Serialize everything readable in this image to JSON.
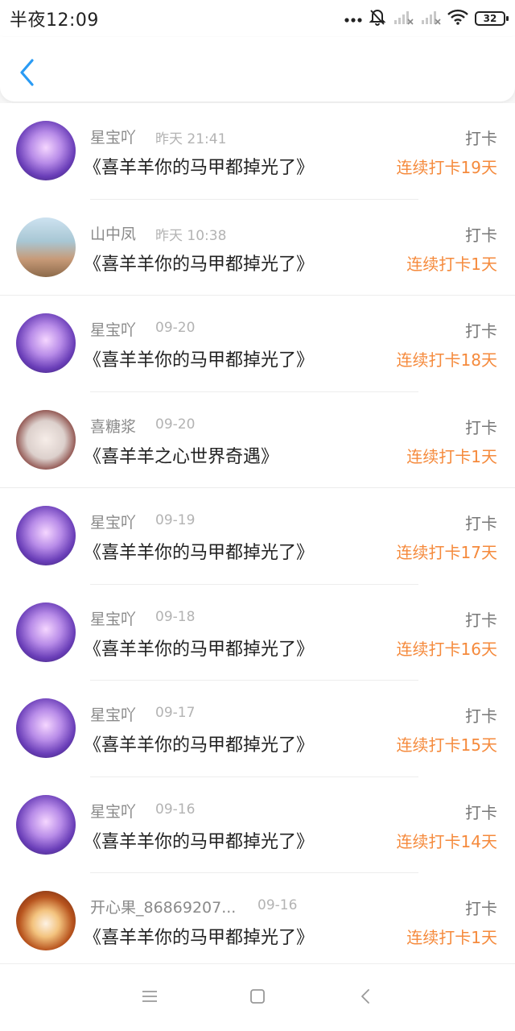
{
  "status_bar": {
    "time": "半夜12:09",
    "battery": "32"
  },
  "header": {
    "back_icon": "chevron-left-icon",
    "accent": "#2a9bf4"
  },
  "colors": {
    "streak": "#f58a3c",
    "name": "#8a8a8a",
    "time": "#b3b3b3"
  },
  "rows": [
    {
      "name": "星宝吖",
      "time": "昨天 21:41",
      "title": "《喜羊羊你的马甲都掉光了》",
      "action": "打卡",
      "streak": "连续打卡19天",
      "avatar": "purple-anime-avatar"
    },
    {
      "name": "山中凤",
      "time": "昨天 10:38",
      "title": "《喜羊羊你的马甲都掉光了》",
      "action": "打卡",
      "streak": "连续打卡1天",
      "avatar": "girl-photo-avatar"
    },
    {
      "name": "星宝吖",
      "time": "09-20",
      "title": "《喜羊羊你的马甲都掉光了》",
      "action": "打卡",
      "streak": "连续打卡18天",
      "avatar": "purple-anime-avatar"
    },
    {
      "name": "喜糖浆",
      "time": "09-20",
      "title": "《喜羊羊之心世界奇遇》",
      "action": "打卡",
      "streak": "连续打卡1天",
      "avatar": "goat-cartoon-avatar"
    },
    {
      "name": "星宝吖",
      "time": "09-19",
      "title": "《喜羊羊你的马甲都掉光了》",
      "action": "打卡",
      "streak": "连续打卡17天",
      "avatar": "purple-anime-avatar"
    },
    {
      "name": "星宝吖",
      "time": "09-18",
      "title": "《喜羊羊你的马甲都掉光了》",
      "action": "打卡",
      "streak": "连续打卡16天",
      "avatar": "purple-anime-avatar"
    },
    {
      "name": "星宝吖",
      "time": "09-17",
      "title": "《喜羊羊你的马甲都掉光了》",
      "action": "打卡",
      "streak": "连续打卡15天",
      "avatar": "purple-anime-avatar"
    },
    {
      "name": "星宝吖",
      "time": "09-16",
      "title": "《喜羊羊你的马甲都掉光了》",
      "action": "打卡",
      "streak": "连续打卡14天",
      "avatar": "purple-anime-avatar"
    },
    {
      "name": "开心果_86869207...",
      "time": "09-16",
      "title": "《喜羊羊你的马甲都掉光了》",
      "action": "打卡",
      "streak": "连续打卡1天",
      "avatar": "fruit-photo-avatar"
    }
  ],
  "nav_bar": {
    "menu_icon": "menu-icon",
    "home_icon": "home-square-icon",
    "back_icon": "back-triangle-icon"
  }
}
